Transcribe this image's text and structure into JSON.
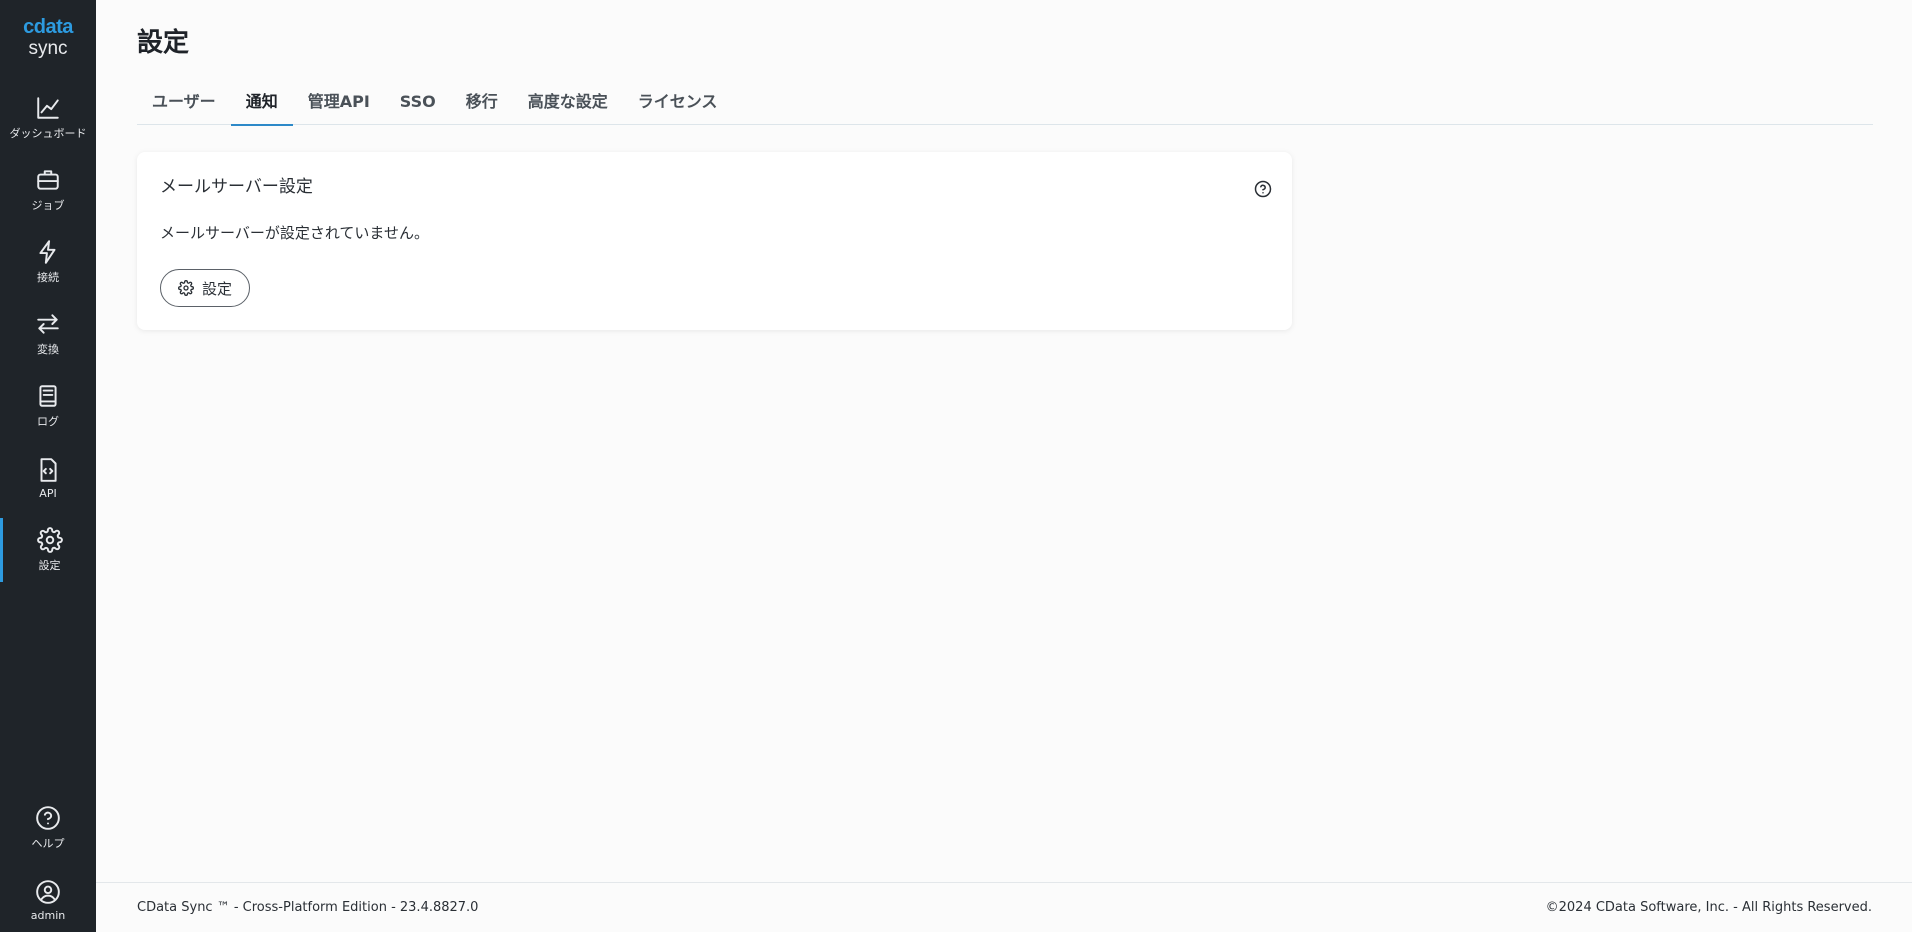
{
  "app": {
    "logo_brand": "cdata",
    "logo_product": "sync"
  },
  "sidebar": {
    "items": [
      {
        "label": "ダッシュボード",
        "icon": "chart-line-icon"
      },
      {
        "label": "ジョブ",
        "icon": "briefcase-icon"
      },
      {
        "label": "接続",
        "icon": "lightning-icon"
      },
      {
        "label": "変換",
        "icon": "transform-arrows-icon"
      },
      {
        "label": "ログ",
        "icon": "book-icon"
      },
      {
        "label": "API",
        "icon": "code-file-icon"
      },
      {
        "label": "設定",
        "icon": "gear-icon",
        "active": true
      }
    ],
    "bottom_items": [
      {
        "label": "ヘルプ",
        "icon": "help-circle-icon"
      },
      {
        "label": "admin",
        "icon": "user-circle-icon"
      }
    ],
    "accent_color": "#2d9be0",
    "background_color": "#1f2429"
  },
  "page": {
    "title": "設定"
  },
  "tabs": [
    {
      "label": "ユーザー"
    },
    {
      "label": "通知",
      "active": true
    },
    {
      "label": "管理API"
    },
    {
      "label": "SSO"
    },
    {
      "label": "移行"
    },
    {
      "label": "高度な設定"
    },
    {
      "label": "ライセンス"
    }
  ],
  "card": {
    "title": "メールサーバー設定",
    "message": "メールサーバーが設定されていません。",
    "button_label": "設定",
    "help_icon": "help-circle-icon"
  },
  "footer": {
    "left": "CData Sync ™ - Cross-Platform Edition - 23.4.8827.0",
    "right": "©2024 CData Software, Inc. - All Rights Reserved."
  }
}
